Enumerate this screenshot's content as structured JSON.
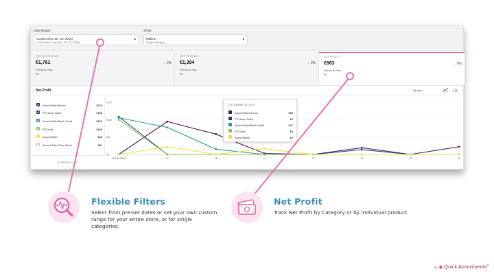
{
  "filters": {
    "date_range_label": "Date Range:",
    "date_range_value": "Custom (Dec 16 - 23, 2019)",
    "date_range_compare": "vs. Previous Year (Dec 16 - 23, 2018)",
    "show_label": "Show:",
    "show_value": "Wallets",
    "show_sub": "Single Category"
  },
  "metrics": [
    {
      "title": "GROSS REVENUE",
      "value": "€1,761",
      "change": "→ 0%",
      "prev_label": "Previous Year:",
      "prev_value": "€0"
    },
    {
      "title": "NET REVENUE",
      "value": "€1,394",
      "change": "→ 0%",
      "prev_label": "Previous Year:",
      "prev_value": "€0"
    },
    {
      "title": "NET PROFIT",
      "value": "€963",
      "change": "→ 0%",
      "prev_label": "Previous Year:",
      "prev_value": "€0"
    }
  ],
  "net_profit": {
    "title": "Net Profit",
    "period": "By day",
    "period_caret": "⌄",
    "line_icon": "line-chart-icon",
    "bar_icon": "bar-chart-icon"
  },
  "legend": [
    {
      "name": "Assar Wallet Brown",
      "value": "€276",
      "color": "#4b1753",
      "checked": true
    },
    {
      "name": "PS Navy Holder",
      "value": "€195",
      "color": "#2b3a7c",
      "checked": true
    },
    {
      "name": "Assar Wallet Black Small",
      "value": "€190",
      "color": "#2a9a98",
      "checked": true
    },
    {
      "name": "PS Black",
      "value": "€180",
      "color": "#7ec94a",
      "checked": true
    },
    {
      "name": "Assar Wallet",
      "value": "€69",
      "color": "#f3e23c",
      "checked": true
    },
    {
      "name": "Assar Wallet Olive Small",
      "value": "€51",
      "color": "#ffffff",
      "checked": false
    }
  ],
  "products_footer": "6 PRODUCTS",
  "chart_data": {
    "type": "line",
    "x": [
      "16 Dec 2019",
      "17",
      "18",
      "19",
      "20",
      "21",
      "22",
      "23"
    ],
    "y_ticks": [
      "€270",
      "€180",
      "€90",
      "€0"
    ],
    "ylim": [
      0,
      270
    ],
    "series": [
      {
        "name": "Assar Wallet Brown",
        "color": "#4b1753",
        "values": [
          0,
          170,
          105,
          5,
          0,
          35,
          0,
          40
        ]
      },
      {
        "name": "PS Navy Holder",
        "color": "#2b3a7c",
        "values": [
          195,
          0,
          0,
          0,
          0,
          25,
          0,
          0
        ]
      },
      {
        "name": "Assar Wallet Black Small",
        "color": "#2a9a98",
        "values": [
          190,
          140,
          27,
          0,
          0,
          0,
          0,
          0
        ]
      },
      {
        "name": "PS Black",
        "color": "#7ec94a",
        "values": [
          180,
          0,
          0,
          0,
          0,
          0,
          0,
          0
        ]
      },
      {
        "name": "Assar Wallet",
        "color": "#f3e23c",
        "values": [
          0,
          40,
          0,
          30,
          0,
          0,
          0,
          0
        ]
      }
    ]
  },
  "tooltip": {
    "date": "DECEMBER 18, 2019",
    "rows": [
      {
        "name": "Assar Wallet Brown",
        "value": "€69",
        "color": "#4b1753"
      },
      {
        "name": "PS Navy Holder",
        "value": "€0",
        "color": "#2b3a7c"
      },
      {
        "name": "Assar Wallet Black Small",
        "value": "€27",
        "color": "#2a9a98"
      },
      {
        "name": "PS Black",
        "value": "€0",
        "color": "#7ec94a"
      },
      {
        "name": "Assar Wallet",
        "value": "€0",
        "color": "#f3e23c"
      }
    ]
  },
  "features": [
    {
      "title": "Flexible Filters",
      "description": "Select from pre-set dates or set your own custom range for your entire store, or for single categories.",
      "icon": "magnifier-pulse-icon"
    },
    {
      "title": "Net Profit",
      "description": "Track Net Profit by Category or by individual product.",
      "icon": "money-icon"
    }
  ],
  "brand": {
    "by": "by",
    "name": "Quick Assortments",
    "reg": "®"
  },
  "colors": {
    "accent_pink": "#e55fa0",
    "title_blue": "#3c8fb0",
    "brand_plum": "#8f3c62"
  }
}
